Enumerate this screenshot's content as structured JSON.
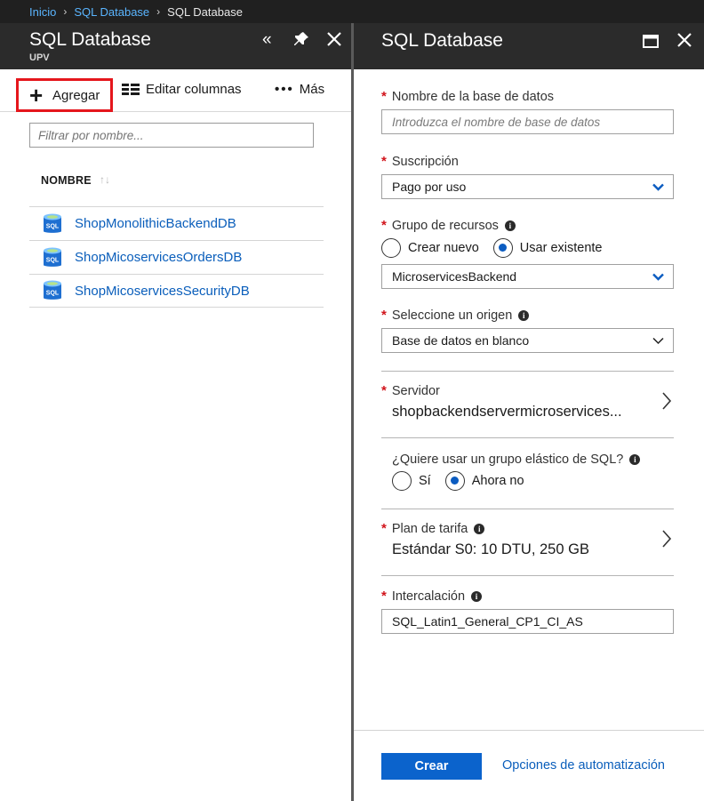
{
  "breadcrumb": {
    "items": [
      {
        "label": "Inicio",
        "link": true
      },
      {
        "label": "SQL Database",
        "link": true
      },
      {
        "label": "SQL Database",
        "link": false
      }
    ]
  },
  "left_blade": {
    "title": "SQL Database",
    "subtitle": "UPV",
    "toolbar": {
      "add_label": "Agregar",
      "columns_label": "Editar columnas",
      "more_label": "Más"
    },
    "filter_placeholder": "Filtrar por nombre...",
    "column_header": "NOMBRE",
    "databases": [
      {
        "name": "ShopMonolithicBackendDB"
      },
      {
        "name": "ShopMicoservicesOrdersDB"
      },
      {
        "name": "ShopMicoservicesSecurityDB"
      }
    ]
  },
  "right_blade": {
    "title": "SQL Database",
    "db_name": {
      "label": "Nombre de la base de datos",
      "placeholder": "Introduzca el nombre de base de datos"
    },
    "subscription": {
      "label": "Suscripción",
      "value": "Pago por uso"
    },
    "resource_group": {
      "label": "Grupo de recursos",
      "option_new": "Crear nuevo",
      "option_existing": "Usar existente",
      "selected": "Usar existente",
      "value": "MicroservicesBackend"
    },
    "source": {
      "label": "Seleccione un origen",
      "value": "Base de datos en blanco"
    },
    "server": {
      "label": "Servidor",
      "value": "shopbackendservermicroservices..."
    },
    "elastic_pool": {
      "question": "¿Quiere usar un grupo elástico de SQL?",
      "option_yes": "Sí",
      "option_no": "Ahora no",
      "selected": "Ahora no"
    },
    "pricing": {
      "label": "Plan de tarifa",
      "value": "Estándar S0: 10 DTU, 250 GB"
    },
    "collation": {
      "label": "Intercalación",
      "value": "SQL_Latin1_General_CP1_CI_AS"
    },
    "create_label": "Crear",
    "automation_label": "Opciones de automatización"
  },
  "icons": {
    "collapse": "double-chevron-left-icon",
    "pin": "pin-icon",
    "close": "close-icon",
    "maximize": "maximize-icon",
    "db": "sql-database-icon",
    "info": "info-icon"
  },
  "colors": {
    "accent": "#0b63cc",
    "link": "#0a5ebb",
    "required": "#d1141b",
    "highlight_border": "#e5161c",
    "header_bg": "#2b2b2b"
  }
}
